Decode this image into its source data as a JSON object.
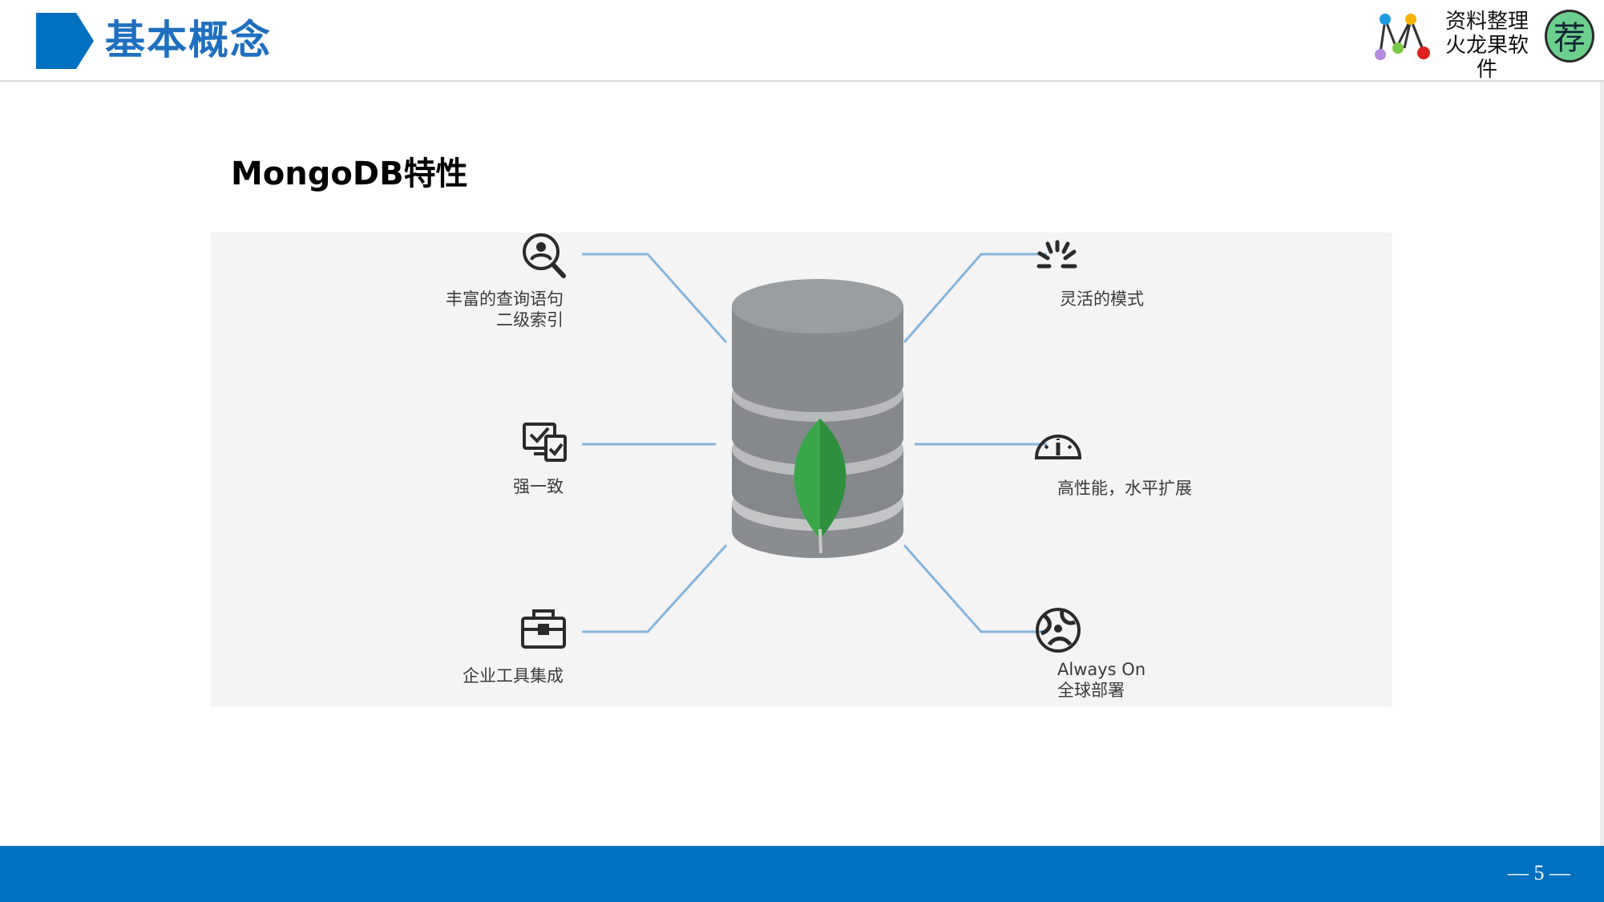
{
  "header": {
    "title": "基本概念",
    "brand_line1": "资料整理",
    "brand_line2": "火龙果软件",
    "badge": "荐"
  },
  "section": {
    "title": "MongoDB特性"
  },
  "diagram": {
    "features": [
      {
        "icon": "search-person-icon",
        "label": "丰富的查询语句\n二级索引"
      },
      {
        "icon": "monitor-check-icon",
        "label": "强一致"
      },
      {
        "icon": "toolbox-icon",
        "label": "企业工具集成"
      },
      {
        "icon": "sparkle-icon",
        "label": "灵活的模式"
      },
      {
        "icon": "speedometer-icon",
        "label": "高性能，水平扩展"
      },
      {
        "icon": "globe-icon",
        "label": "Always On\n全球部署"
      }
    ]
  },
  "footer": {
    "page": "— 5 —"
  },
  "colors": {
    "accent": "#0070c0",
    "title": "#1f6fbf",
    "connector": "#86b5dc",
    "leaf": "#3fa34d",
    "database": "#8e9194"
  }
}
